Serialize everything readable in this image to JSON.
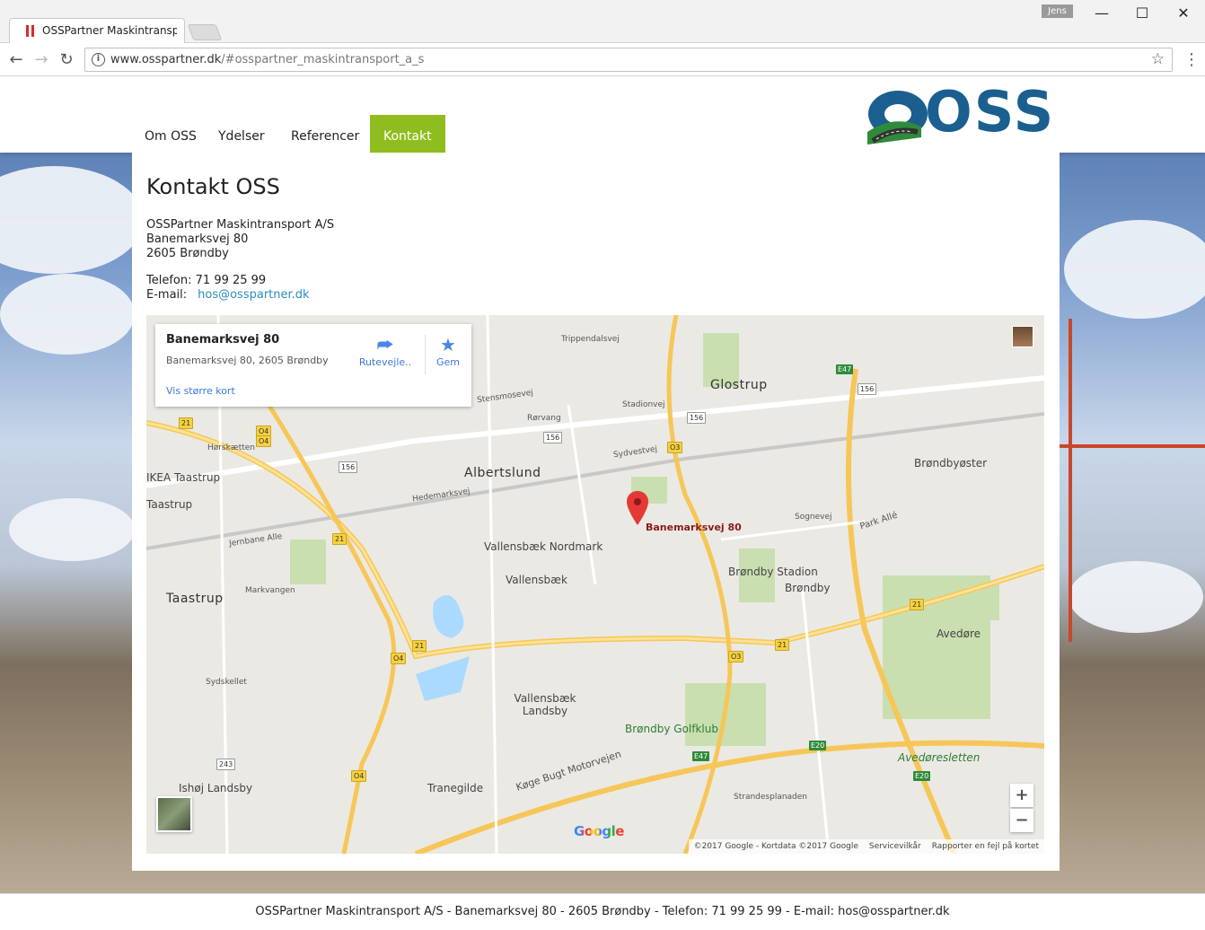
{
  "browser": {
    "tab_title": "OSSPartner Maskintransp",
    "user": "Jens",
    "url_host": "www.osspartner.dk",
    "url_path": "/#osspartner_maskintransport_a_s",
    "win_minimize": "—",
    "win_maximize": "☐",
    "win_close": "✕"
  },
  "site": {
    "logo_text": "OSS",
    "brand_color": "#1a5f8f",
    "accent_color": "#8fbd1f",
    "nav": [
      {
        "label": "Om OSS",
        "active": false
      },
      {
        "label": "Ydelser",
        "active": false
      },
      {
        "label": "Referencer",
        "active": false
      },
      {
        "label": "Kontakt",
        "active": true
      }
    ]
  },
  "content": {
    "title": "Kontakt OSS",
    "address": [
      "OSSPartner Maskintransport A/S",
      "Banemarksvej 80",
      "2605 Brøndby"
    ],
    "phone_label": "Telefon:",
    "phone": "71 99 25 99",
    "email_label": "E-mail:",
    "email": "hos@osspartner.dk"
  },
  "map": {
    "card_title": "Banemarksvej 80",
    "card_subtitle": "Banemarksvej 80, 2605 Brøndby",
    "card_link": "Vis større kort",
    "directions_label": "Rutevejle..",
    "save_label": "Gem",
    "pin_label": "Banemarksvej 80",
    "zoom_in": "+",
    "zoom_out": "−",
    "google": "Google",
    "attribution": "©2017 Google - Kortdata ©2017 Google",
    "terms": "Servicevilkår",
    "report": "Rapporter en fejl på kortet",
    "places": {
      "glostrup": "Glostrup",
      "albertslund": "Albertslund",
      "taastrup": "Taastrup",
      "vallensbaek_nordmark": "Vallensbæk Nordmark",
      "vallensbaek": "Vallensbæk",
      "vallensbaek_landsby": "Vallensbæk Landsby",
      "brondby": "Brøndby",
      "brondby_stadion": "Brøndby Stadion",
      "brondbyoster": "Brøndbyøster",
      "avedore": "Avedøre",
      "avedoresletten": "Avedøresletten",
      "ikea": "IKEA Taastrup",
      "taastrup2": "Taastrup",
      "ishoj": "Ishøj Landsby",
      "tranegilde": "Tranegilde",
      "golfklub": "Brøndby Golfklub",
      "koge_bugt": "Køge Bugt Motorvejen"
    },
    "roads": {
      "r156": "156",
      "r21": "21",
      "o4": "O4",
      "o3": "O3",
      "e47": "E47",
      "e20": "E20",
      "r243": "243",
      "trippendalsvej": "Trippendalsvej",
      "stensmosevej": "Stensmosevej",
      "rorvang": "Rørvang",
      "hedemarksvej": "Hedemarksvej",
      "sydvestvej": "Sydvestvej",
      "sognevej": "Sognevej",
      "park_alle": "Park Allé",
      "horskaetten": "Hørskætten",
      "jernbane_alle": "Jernbane Alle",
      "markvangen": "Markvangen",
      "stadionvej": "Stadionvej",
      "strandesplanaden": "Strandesplanaden",
      "sydskellet": "Sydskellet"
    }
  },
  "footer": "OSSPartner Maskintransport A/S - Banemarksvej 80 - 2605 Brøndby - Telefon: 71 99 25 99 - E-mail: hos@osspartner.dk"
}
